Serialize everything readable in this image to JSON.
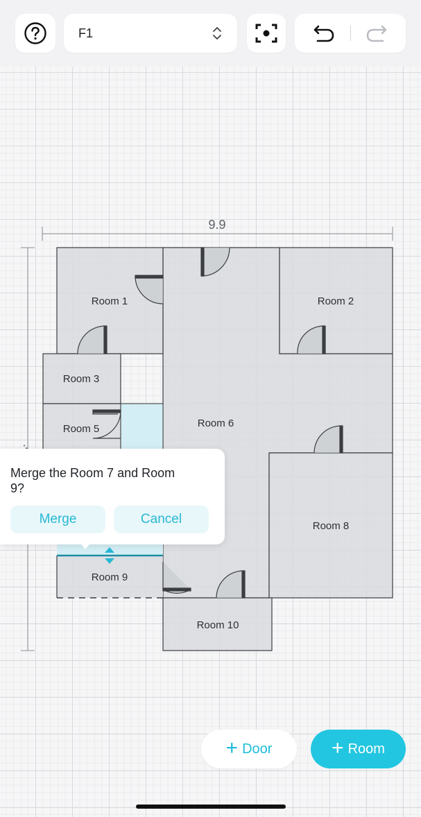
{
  "toolbar": {
    "help_icon": "question-circle-icon",
    "floor_value": "F1",
    "floor_chevron_icon": "chevron-up-down-icon",
    "focus_icon": "center-focus-icon",
    "undo_icon": "undo-icon",
    "redo_icon": "redo-icon"
  },
  "plan": {
    "width_dimension": "9.9",
    "height_dimension_fragment": ".4",
    "rooms": [
      "Room 1",
      "Room 2",
      "Room 3",
      "Room 5",
      "Room 6",
      "Room 8",
      "Room 9",
      "Room 10"
    ]
  },
  "merge_dialog": {
    "question": "Merge the Room 7 and Room 9?",
    "merge_label": "Merge",
    "cancel_label": "Cancel"
  },
  "actions": {
    "door_label": "Door",
    "room_label": "Room"
  },
  "colors": {
    "accent": "#22c6e0",
    "accent_text": "#27b8d3",
    "room_fill": "#d9dbde",
    "selected_room_fill": "#d3eef4",
    "wall": "#3a3d41"
  }
}
